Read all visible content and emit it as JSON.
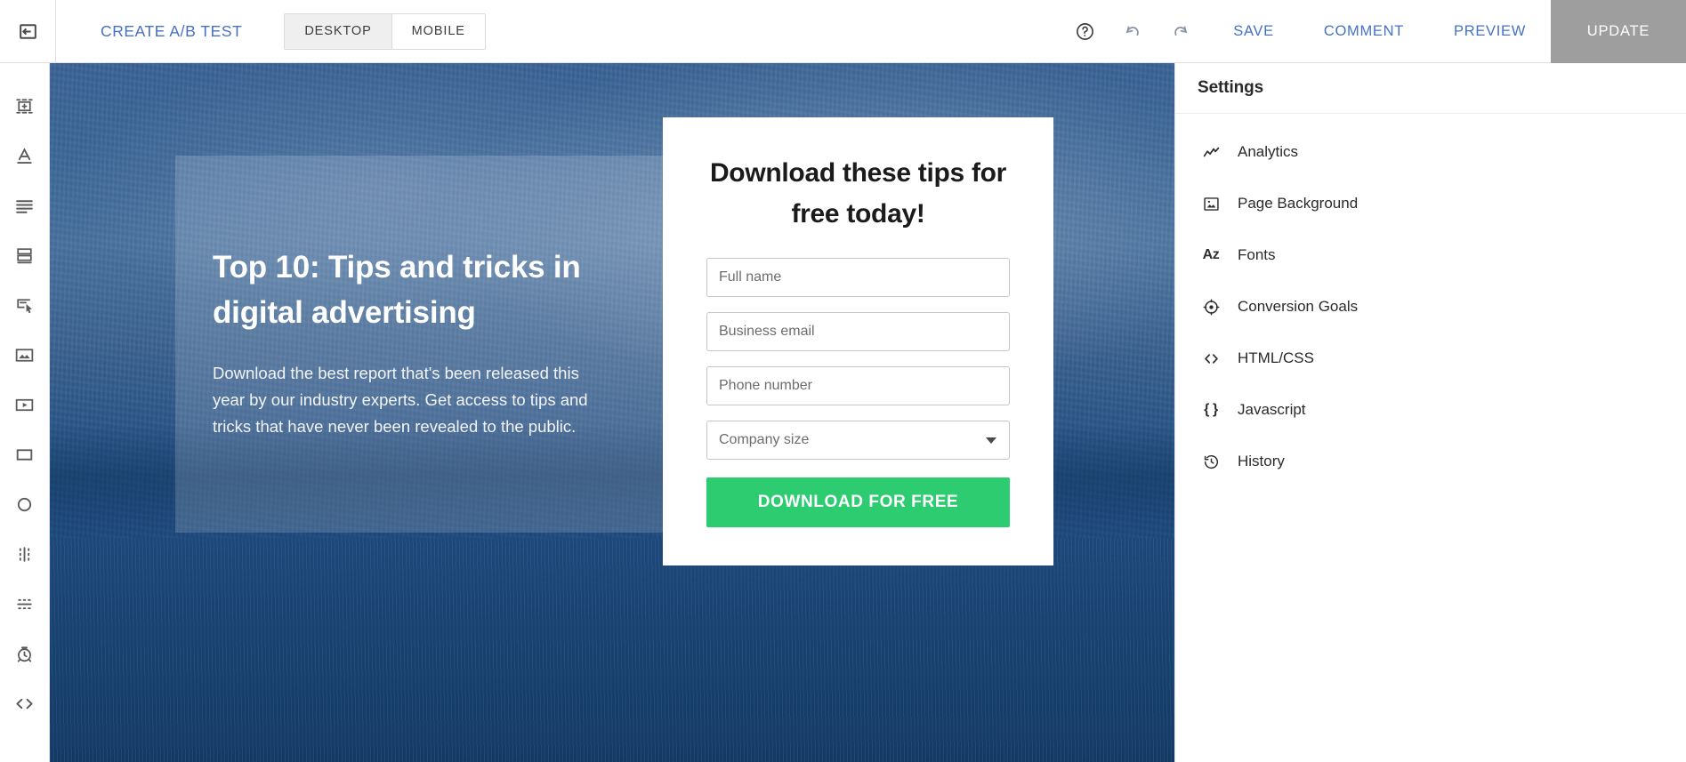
{
  "toolbar": {
    "back_icon": "exit-left-icon",
    "create_ab_test": "CREATE A/B TEST",
    "viewport_modes": [
      {
        "label": "DESKTOP",
        "active": true
      },
      {
        "label": "MOBILE",
        "active": false
      }
    ],
    "help_icon": "help-circle-icon",
    "undo_icon": "undo-arrow-icon",
    "redo_icon": "redo-arrow-icon",
    "save": "SAVE",
    "comment": "COMMENT",
    "preview": "PREVIEW",
    "update": "UPDATE",
    "link_color": "#4671c6",
    "update_bg": "#9e9e9e"
  },
  "left_rail": {
    "items": [
      {
        "icon": "add-section-icon"
      },
      {
        "icon": "text-icon"
      },
      {
        "icon": "paragraph-icon"
      },
      {
        "icon": "rows-icon"
      },
      {
        "icon": "button-click-icon"
      },
      {
        "icon": "image-icon"
      },
      {
        "icon": "video-icon"
      },
      {
        "icon": "box-icon"
      },
      {
        "icon": "circle-icon"
      },
      {
        "icon": "vertical-divider-icon"
      },
      {
        "icon": "horizontal-divider-icon"
      },
      {
        "icon": "countdown-timer-icon"
      },
      {
        "icon": "code-icon"
      }
    ]
  },
  "canvas": {
    "background_color": "#1f4e82",
    "hero": {
      "title": "Top 10: Tips and tricks in digital advertising",
      "body": "Download the best report that's been released this year by our industry experts. Get access to tips and tricks that have never been revealed to the public."
    },
    "form": {
      "title": "Download these tips for free today!",
      "fields": [
        {
          "name": "full-name",
          "placeholder": "Full name",
          "type": "text"
        },
        {
          "name": "business-email",
          "placeholder": "Business email",
          "type": "text"
        },
        {
          "name": "phone-number",
          "placeholder": "Phone number",
          "type": "text"
        },
        {
          "name": "company-size",
          "placeholder": "Company size",
          "type": "select"
        }
      ],
      "cta_label": "DOWNLOAD FOR FREE",
      "cta_color": "#2ecc71"
    }
  },
  "settings": {
    "title": "Settings",
    "items": [
      {
        "label": "Analytics",
        "icon": "analytics-trend-icon"
      },
      {
        "label": "Page Background",
        "icon": "image-icon"
      },
      {
        "label": "Fonts",
        "icon": "fonts-az-icon",
        "glyph": "Az"
      },
      {
        "label": "Conversion Goals",
        "icon": "target-icon"
      },
      {
        "label": "HTML/CSS",
        "icon": "code-angle-brackets-icon"
      },
      {
        "label": "Javascript",
        "icon": "curly-braces-icon",
        "glyph": "{ }"
      },
      {
        "label": "History",
        "icon": "history-clock-icon"
      }
    ]
  }
}
